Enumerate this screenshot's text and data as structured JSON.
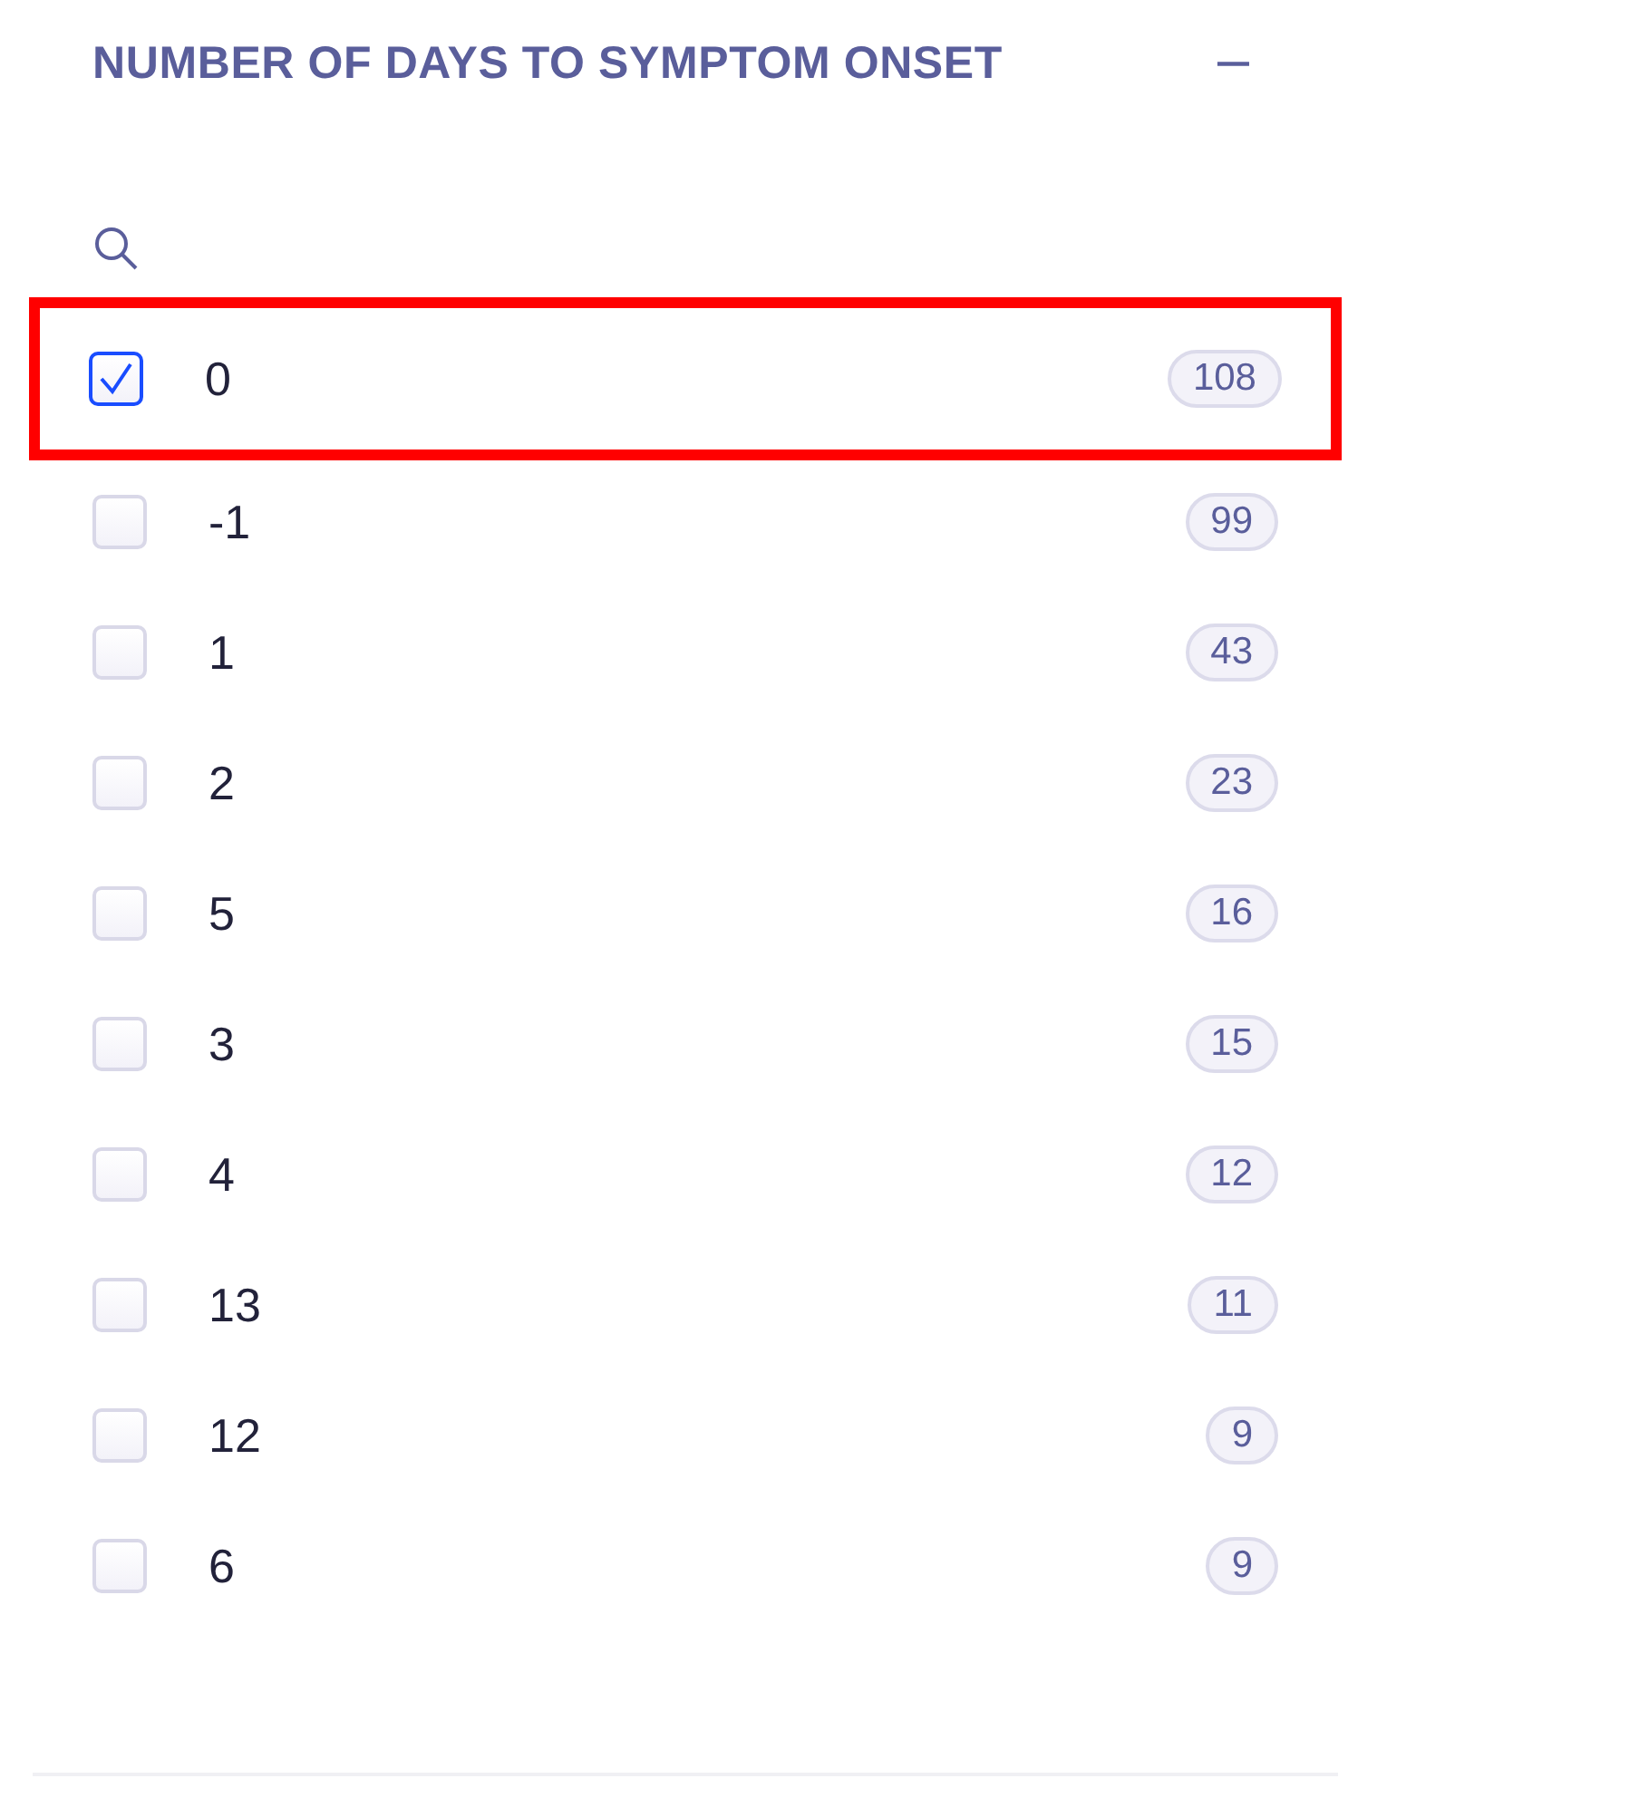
{
  "filter": {
    "title": "NUMBER OF DAYS TO SYMPTOM ONSET",
    "collapse_icon": "−",
    "expanded": true,
    "options": [
      {
        "label": "0",
        "count": "108",
        "checked": true,
        "highlighted": true
      },
      {
        "label": "-1",
        "count": "99",
        "checked": false,
        "highlighted": false
      },
      {
        "label": "1",
        "count": "43",
        "checked": false,
        "highlighted": false
      },
      {
        "label": "2",
        "count": "23",
        "checked": false,
        "highlighted": false
      },
      {
        "label": "5",
        "count": "16",
        "checked": false,
        "highlighted": false
      },
      {
        "label": "3",
        "count": "15",
        "checked": false,
        "highlighted": false
      },
      {
        "label": "4",
        "count": "12",
        "checked": false,
        "highlighted": false
      },
      {
        "label": "13",
        "count": "11",
        "checked": false,
        "highlighted": false
      },
      {
        "label": "12",
        "count": "9",
        "checked": false,
        "highlighted": false
      },
      {
        "label": "6",
        "count": "9",
        "checked": false,
        "highlighted": false
      }
    ]
  }
}
